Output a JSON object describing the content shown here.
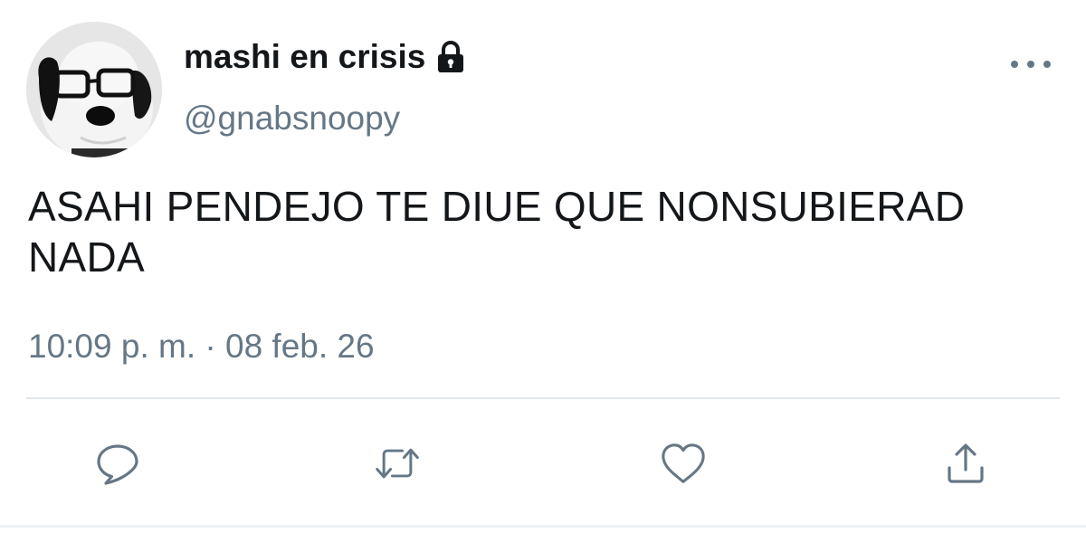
{
  "tweet": {
    "display_name": "mashi en crisis",
    "handle": "@gnabsnoopy",
    "text": "ASAHI PENDEJO TE DIUE QUE NONSUBIERAD NADA",
    "timestamp": "10:09 p. m. · 08 feb. 26",
    "protected_icon": "lock-icon",
    "avatar": "snoopy-with-glasses"
  },
  "actions": [
    {
      "name": "reply",
      "icon": "reply-icon"
    },
    {
      "name": "retweet",
      "icon": "retweet-icon"
    },
    {
      "name": "like",
      "icon": "heart-icon"
    },
    {
      "name": "share",
      "icon": "share-icon"
    }
  ],
  "menu": {
    "icon": "more-icon"
  },
  "colors": {
    "text": "#14171a",
    "secondary": "#657786",
    "divider": "#e1e8ed"
  }
}
